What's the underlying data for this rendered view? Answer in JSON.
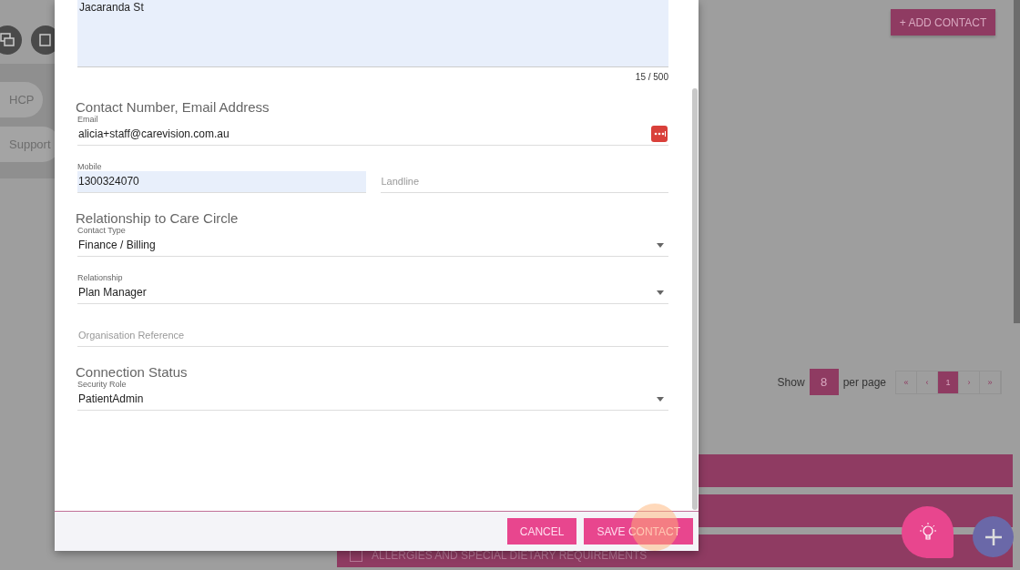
{
  "page": {
    "add_contact_button": "+ ADD CONTACT",
    "chips": [
      "HCP",
      "Support"
    ],
    "pagination": {
      "show_label": "Show",
      "per_page_value": "8",
      "per_page_label": "per page",
      "buttons": [
        {
          "label": "«",
          "selected": false
        },
        {
          "label": "‹",
          "selected": false
        },
        {
          "label": "1",
          "selected": true
        },
        {
          "label": "›",
          "selected": false
        },
        {
          "label": "»",
          "selected": false
        }
      ]
    },
    "section_bars": [
      {
        "kind": "plain"
      },
      {
        "kind": "plain"
      },
      {
        "kind": "checkbox",
        "label": "ALLERGIES AND SPECIAL DIETARY REQUIREMENTS",
        "checked": false
      }
    ]
  },
  "dialog": {
    "address": {
      "value": "Jacaranda St",
      "counter": "15 / 500"
    },
    "sections": [
      {
        "title": "Contact Number, Email Address",
        "rows": [
          [
            {
              "kind": "text-action",
              "label": "Email",
              "value": "alicia+staff@carevision.com.au",
              "autofilled": false
            }
          ],
          [
            {
              "kind": "text",
              "label": "Mobile",
              "value": "1300324070",
              "autofilled": true
            },
            {
              "kind": "text",
              "placeholder": "Landline",
              "autofilled": false
            }
          ]
        ]
      },
      {
        "title": "Relationship to Care Circle",
        "rows": [
          [
            {
              "kind": "select",
              "label": "Contact Type",
              "value": "Finance / Billing",
              "autofilled": false
            }
          ],
          [
            {
              "kind": "select",
              "label": "Relationship",
              "value": "Plan Manager",
              "autofilled": false
            }
          ],
          [
            {
              "kind": "text",
              "placeholder": "Organisation Reference",
              "autofilled": false
            }
          ]
        ]
      },
      {
        "title": "Connection Status",
        "rows": [
          [
            {
              "kind": "select",
              "label": "Security Role",
              "value": "PatientAdmin",
              "autofilled": false
            }
          ]
        ]
      }
    ],
    "buttons": [
      {
        "kind": "cancel",
        "label": "CANCEL"
      },
      {
        "kind": "save",
        "label": "SAVE CONTACT",
        "clicked": true
      }
    ]
  }
}
